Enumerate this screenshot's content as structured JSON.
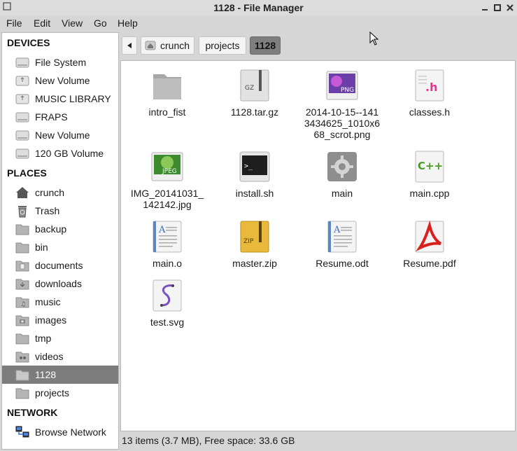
{
  "window": {
    "title": "1128 - File Manager"
  },
  "menubar": [
    "File",
    "Edit",
    "View",
    "Go",
    "Help"
  ],
  "sidebar": {
    "devices_header": "DEVICES",
    "devices": [
      {
        "label": "File System",
        "icon": "drive-icon"
      },
      {
        "label": "New Volume",
        "icon": "usb-drive-icon"
      },
      {
        "label": "MUSIC LIBRARY",
        "icon": "usb-drive-icon"
      },
      {
        "label": "FRAPS",
        "icon": "drive-icon"
      },
      {
        "label": "New Volume",
        "icon": "drive-icon"
      },
      {
        "label": "120 GB Volume",
        "icon": "drive-icon"
      }
    ],
    "places_header": "PLACES",
    "places": [
      {
        "label": "crunch",
        "icon": "home-icon"
      },
      {
        "label": "Trash",
        "icon": "trash-icon"
      },
      {
        "label": "backup",
        "icon": "folder-icon"
      },
      {
        "label": "bin",
        "icon": "folder-icon"
      },
      {
        "label": "documents",
        "icon": "folder-documents-icon"
      },
      {
        "label": "downloads",
        "icon": "folder-downloads-icon"
      },
      {
        "label": "music",
        "icon": "folder-music-icon"
      },
      {
        "label": "images",
        "icon": "folder-images-icon"
      },
      {
        "label": "tmp",
        "icon": "folder-icon"
      },
      {
        "label": "videos",
        "icon": "folder-videos-icon"
      },
      {
        "label": "1128",
        "icon": "folder-icon",
        "selected": true
      },
      {
        "label": "projects",
        "icon": "folder-icon"
      }
    ],
    "network_header": "NETWORK",
    "network": [
      {
        "label": "Browse Network",
        "icon": "network-icon"
      }
    ]
  },
  "pathbar": {
    "crumbs": [
      {
        "label": "crunch",
        "icon": "home-icon"
      },
      {
        "label": "projects"
      },
      {
        "label": "1128",
        "active": true
      }
    ]
  },
  "files": [
    {
      "label": "intro_fist",
      "icon": "folder-icon"
    },
    {
      "label": "1128.tar.gz",
      "icon": "archive-gz-icon",
      "badge": "GZ"
    },
    {
      "label": "2014-10-15--141 3434625_1010x6 68_scrot.png",
      "icon": "image-png-icon",
      "badge": "PNG"
    },
    {
      "label": "classes.h",
      "icon": "header-file-icon",
      "badge": ".h"
    },
    {
      "label": "IMG_20141031_ 142142.jpg",
      "icon": "image-jpeg-icon",
      "badge": "JPEG"
    },
    {
      "label": "install.sh",
      "icon": "terminal-script-icon",
      "badge": ">_"
    },
    {
      "label": "main",
      "icon": "executable-gear-icon"
    },
    {
      "label": "main.cpp",
      "icon": "cpp-source-icon",
      "badge": "C++"
    },
    {
      "label": "main.o",
      "icon": "document-text-icon",
      "badge": "A"
    },
    {
      "label": "master.zip",
      "icon": "archive-zip-icon",
      "badge": "ZIP"
    },
    {
      "label": "Resume.odt",
      "icon": "document-text-icon",
      "badge": "A"
    },
    {
      "label": "Resume.pdf",
      "icon": "pdf-icon"
    },
    {
      "label": "test.svg",
      "icon": "svg-image-icon"
    }
  ],
  "status": {
    "text": "13 items (3.7 MB), Free space: 33.6 GB"
  },
  "colors": {
    "selection": "#7c7c7c",
    "accent": "#e8328f"
  }
}
